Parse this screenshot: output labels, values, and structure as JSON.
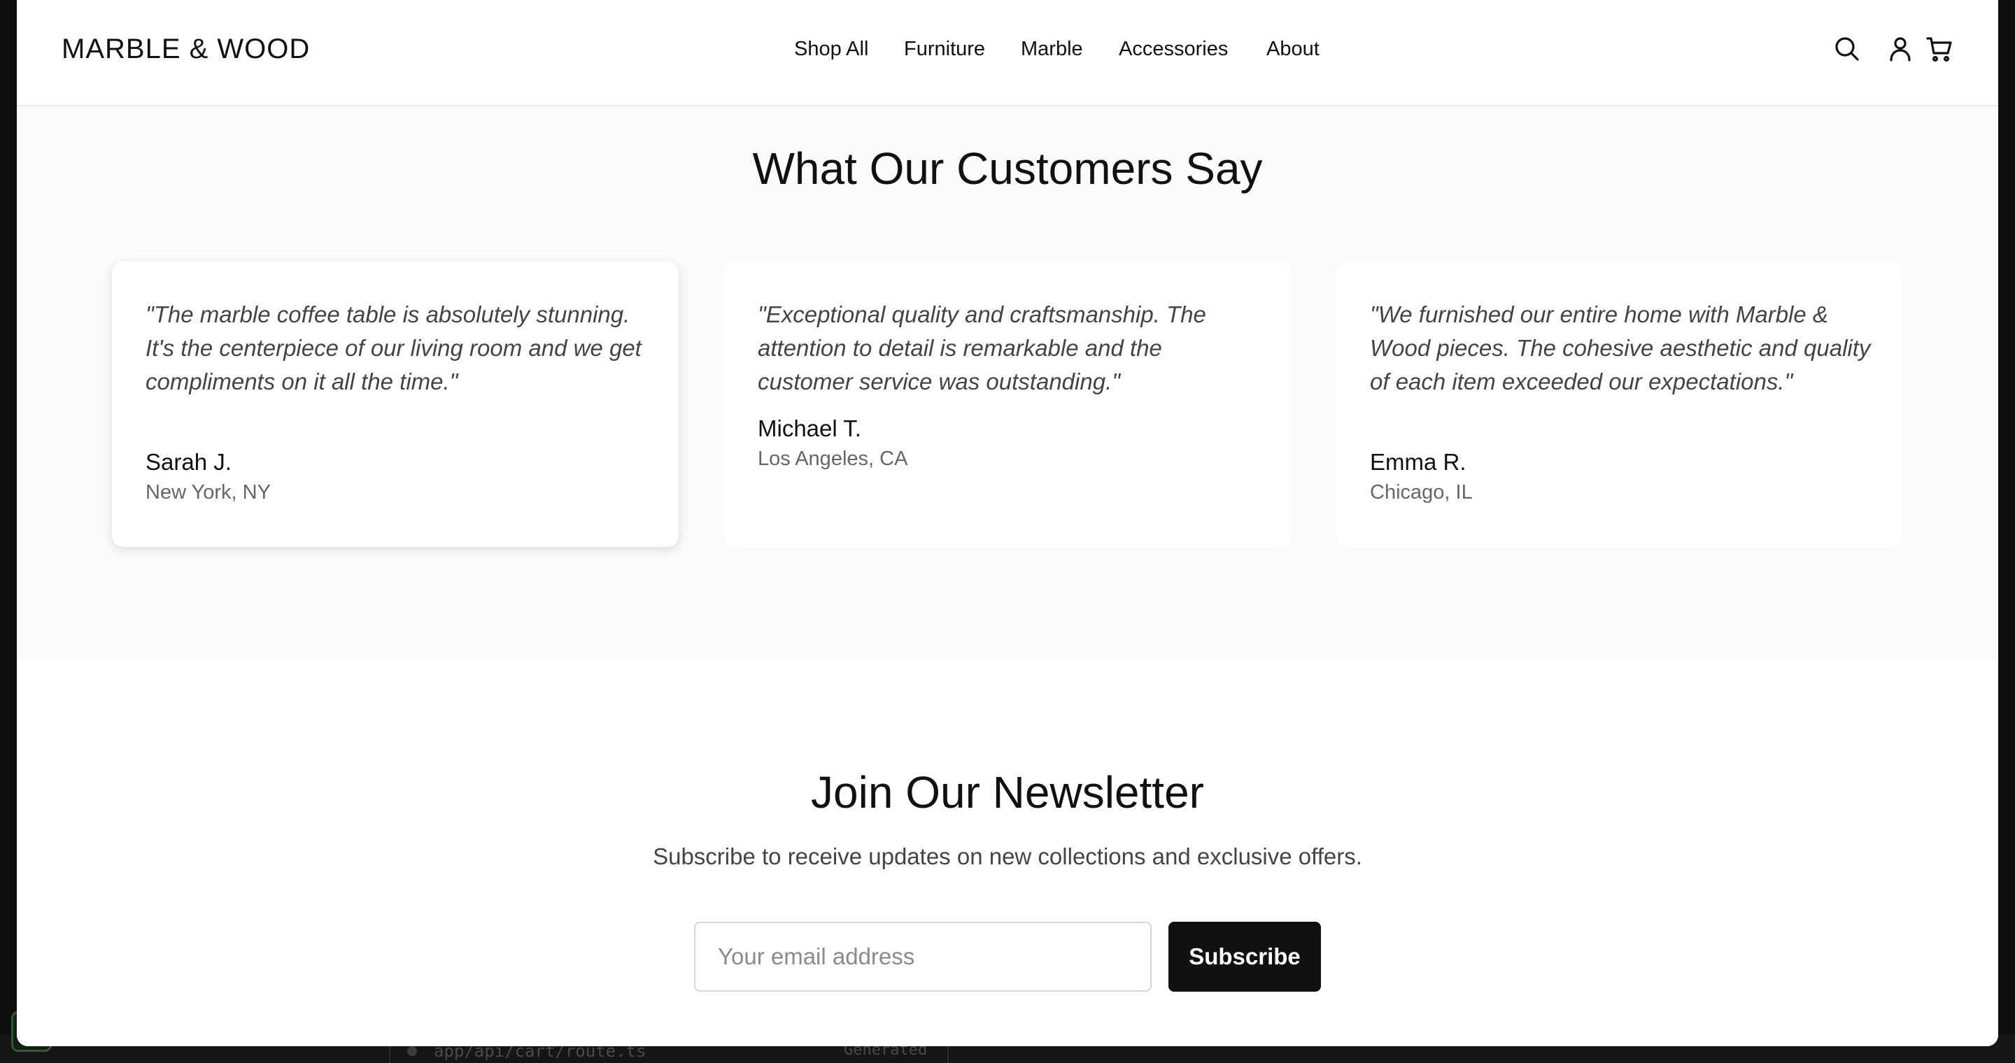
{
  "brand": {
    "logo_text": "MARBLE & WOOD"
  },
  "nav": {
    "items": [
      {
        "label": "Shop All"
      },
      {
        "label": "Furniture"
      },
      {
        "label": "Marble"
      },
      {
        "label": "Accessories"
      },
      {
        "label": "About"
      }
    ]
  },
  "header_icons": [
    "search-icon",
    "user-icon",
    "cart-icon"
  ],
  "testimonials": {
    "title": "What Our Customers Say",
    "items": [
      {
        "quote": "\"The marble coffee table is absolutely stunning. It's the centerpiece of our living room and we get compliments on it all the time.\"",
        "author": "Sarah J.",
        "location": "New York, NY"
      },
      {
        "quote": "\"Exceptional quality and craftsmanship. The attention to detail is remarkable and the customer service was outstanding.\"",
        "author": "Michael T.",
        "location": "Los Angeles, CA"
      },
      {
        "quote": "\"We furnished our entire home with Marble & Wood pieces. The cohesive aesthetic and quality of each item exceeded our expectations.\"",
        "author": "Emma R.",
        "location": "Chicago, IL"
      }
    ]
  },
  "newsletter": {
    "title": "Join Our Newsletter",
    "subtitle": "Subscribe to receive updates on new collections and exclusive offers.",
    "email_placeholder": "Your email address",
    "email_value": "",
    "subscribe_label": "Subscribe"
  },
  "background_editor": {
    "file_path": "app/api/cart/route.ts",
    "tag": "Generated"
  },
  "colors": {
    "page_bg": "#ffffff",
    "section_bg": "#fafafa",
    "text_primary": "#111111",
    "text_muted": "#666666",
    "button_bg": "#111111"
  }
}
